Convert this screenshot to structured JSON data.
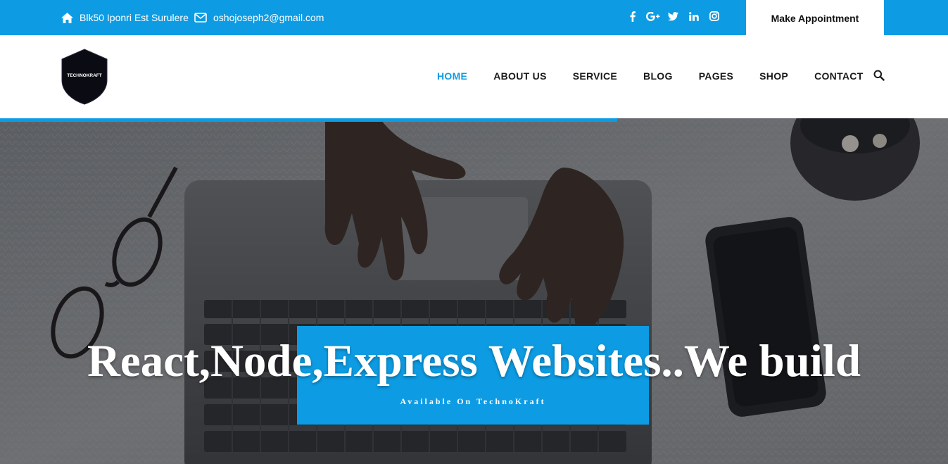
{
  "topbar": {
    "address": "Blk50 Iponri Est Surulere",
    "email": "oshojoseph2@gmail.com",
    "appointment_label": "Make Appointment",
    "socials": [
      "facebook-icon",
      "google-plus-icon",
      "twitter-icon",
      "linkedin-icon",
      "instagram-icon"
    ]
  },
  "header": {
    "logo_text": "TECHNOKRAFT",
    "nav": [
      {
        "label": "HOME",
        "active": true
      },
      {
        "label": "ABOUT US",
        "active": false
      },
      {
        "label": "SERVICE",
        "active": false
      },
      {
        "label": "BLOG",
        "active": false
      },
      {
        "label": "PAGES",
        "active": false
      },
      {
        "label": "SHOP",
        "active": false
      },
      {
        "label": "CONTACT",
        "active": false
      }
    ]
  },
  "hero": {
    "title": "React,Node,Express Websites..We build",
    "subtitle": "Available On TechnoKraft"
  },
  "colors": {
    "accent": "#0d9ce3",
    "text_dark": "#1a1a1a",
    "white": "#ffffff"
  }
}
